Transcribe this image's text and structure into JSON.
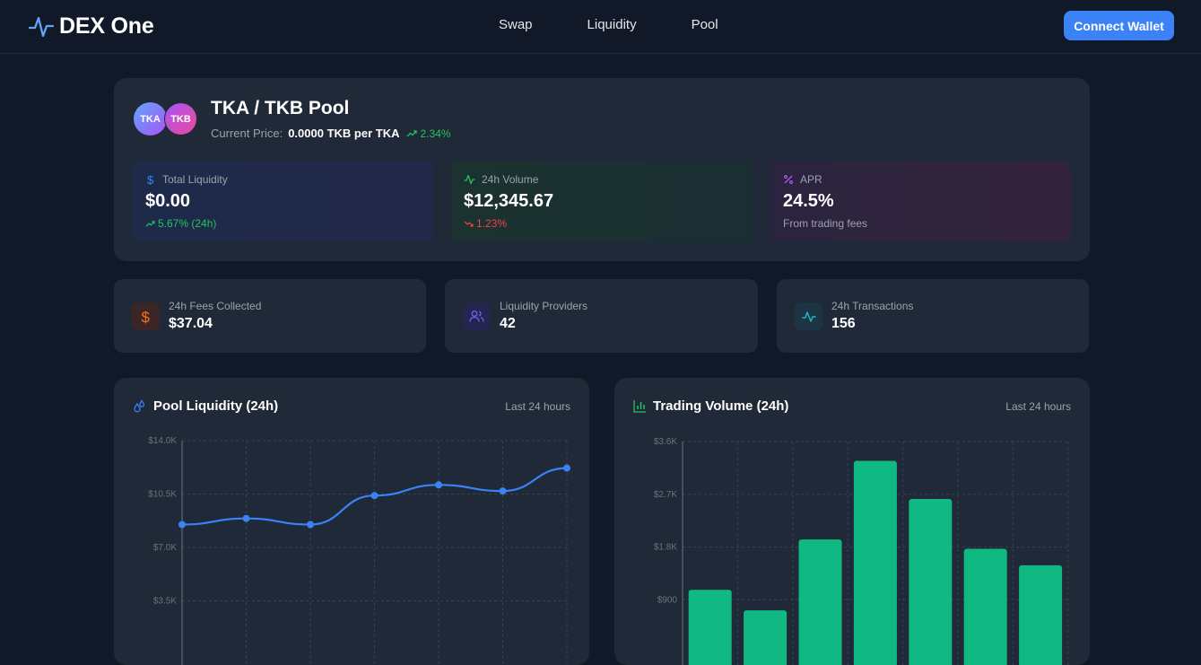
{
  "app": {
    "brand_name": "DEX One",
    "nav": [
      "Swap",
      "Liquidity",
      "Pool"
    ],
    "connect_label": "Connect Wallet"
  },
  "pool": {
    "token_a": "TKA",
    "token_b": "TKB",
    "title": "TKA / TKB Pool",
    "price_label": "Current Price:",
    "price_value": "0.0000 TKB per TKA",
    "price_change": "2.34%",
    "stats": {
      "liquidity": {
        "label": "Total Liquidity",
        "value": "$0.00",
        "sub": "5.67% (24h)"
      },
      "volume": {
        "label": "24h Volume",
        "value": "$12,345.67",
        "sub": "1.23%"
      },
      "apr": {
        "label": "APR",
        "value": "24.5%",
        "sub": "From trading fees"
      }
    }
  },
  "mini": {
    "fees": {
      "label": "24h Fees Collected",
      "value": "$37.04"
    },
    "providers": {
      "label": "Liquidity Providers",
      "value": "42"
    },
    "transactions": {
      "label": "24h Transactions",
      "value": "156"
    }
  },
  "charts": {
    "liquidity_title": "Pool Liquidity (24h)",
    "volume_title": "Trading Volume (24h)",
    "range_label": "Last 24 hours"
  },
  "colors": {
    "accent": "#3b82f6",
    "up": "#22c55e",
    "down": "#ef4444",
    "bar": "#10b981"
  },
  "chart_data": [
    {
      "type": "line",
      "title": "Pool Liquidity (24h)",
      "y_ticks": [
        "$14.0K",
        "$10.5K",
        "$7.0K",
        "$3.5K"
      ],
      "ylim": [
        0,
        14000
      ],
      "values": [
        8500,
        8900,
        8500,
        10400,
        11100,
        10700,
        12200
      ],
      "grid": true
    },
    {
      "type": "bar",
      "title": "Trading Volume (24h)",
      "y_ticks": [
        "$3.6K",
        "$2.7K",
        "$1.8K",
        "$900"
      ],
      "ylim": [
        0,
        3600
      ],
      "values": [
        1070,
        720,
        1930,
        3270,
        2620,
        1770,
        1490
      ],
      "grid": true
    }
  ]
}
